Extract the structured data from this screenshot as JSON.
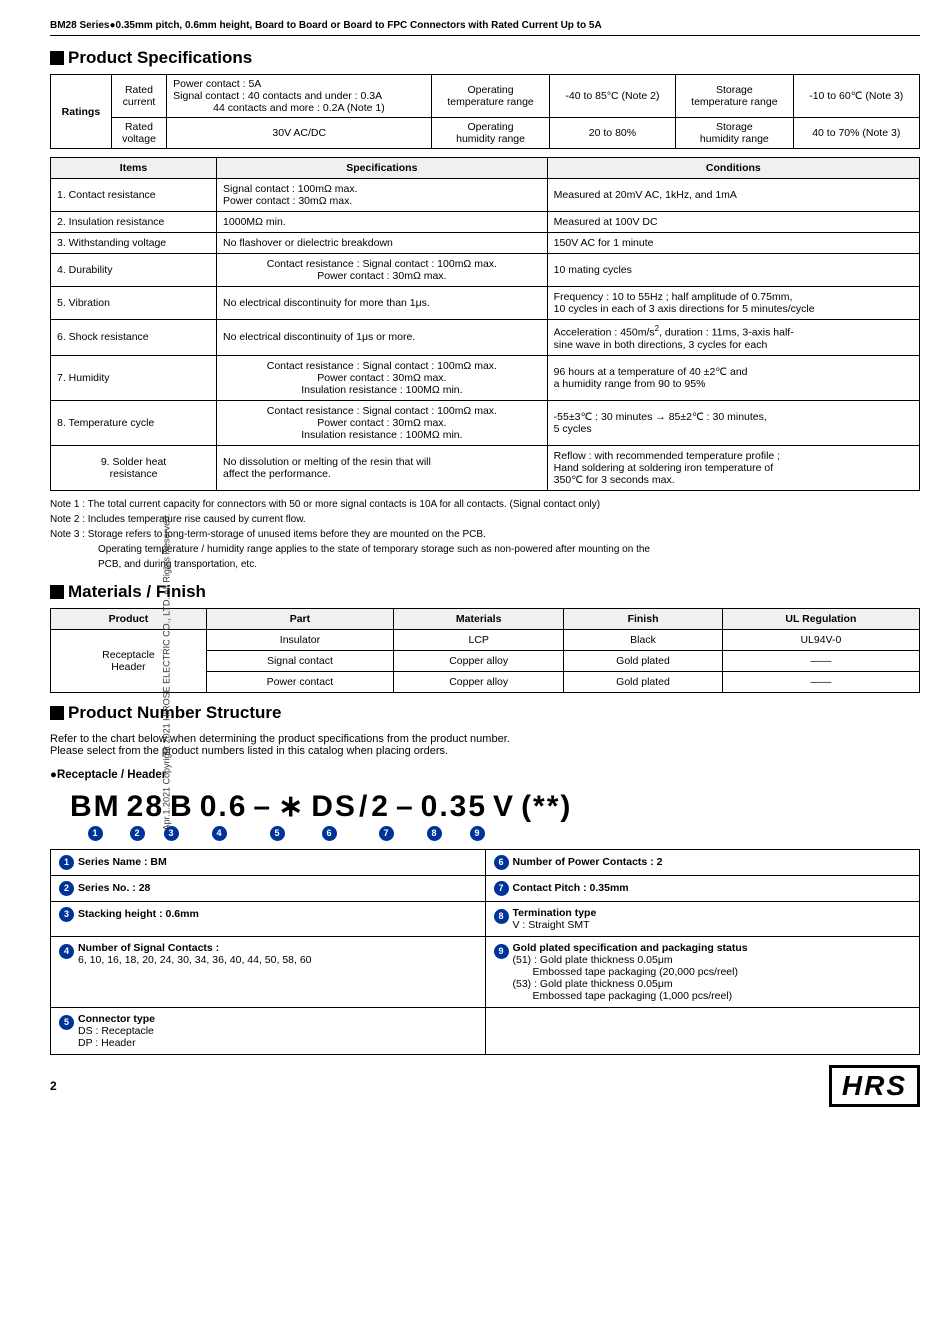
{
  "header": {
    "title": "BM28 Series●0.35mm pitch, 0.6mm height, Board to Board or Board to FPC Connectors with Rated Current Up to 5A"
  },
  "sidebar_text": "Apr.1.2021 Copyright 2021 HIROSE ELECTRIC CO., LTD. All Rights Reserved.",
  "product_specs": {
    "section_title": "Product Specifications",
    "ratings": {
      "label": "Ratings",
      "rows": [
        {
          "left_label": "Rated current",
          "left_value": "Power contact : 5A\nSignal contact : 40 contacts and under : 0.3A\n44 contacts and more : 0.2A (Note 1)",
          "mid_label": "Operating temperature range",
          "mid_value": "-40 to 85°C (Note 2)",
          "right_label": "Storage temperature range",
          "right_value": "-10 to 60℃ (Note 3)"
        },
        {
          "left_label": "Rated voltage",
          "left_value": "30V AC/DC",
          "mid_label": "Operating humidity range",
          "mid_value": "20 to 80%",
          "right_label": "Storage humidity range",
          "right_value": "40 to 70% (Note 3)"
        }
      ]
    },
    "main_table": {
      "headers": [
        "Items",
        "Specifications",
        "Conditions"
      ],
      "rows": [
        {
          "item": "1. Contact resistance",
          "spec": "Signal contact : 100mΩ max.\nPower contact : 30mΩ max.",
          "cond": "Measured at 20mV AC, 1kHz, and 1mA"
        },
        {
          "item": "2. Insulation resistance",
          "spec": "1000MΩ min.",
          "cond": "Measured at 100V DC"
        },
        {
          "item": "3. Withstanding voltage",
          "spec": "No flashover or dielectric breakdown",
          "cond": "150V AC for 1 minute"
        },
        {
          "item": "4. Durability",
          "spec": "Contact resistance : Signal contact : 100mΩ max.\nPower contact : 30mΩ max.",
          "cond": "10 mating cycles"
        },
        {
          "item": "5. Vibration",
          "spec": "No electrical discontinuity for more than 1μs.",
          "cond": "Frequency : 10 to 55Hz ; half amplitude of 0.75mm,\n10 cycles in each of 3 axis directions for 5 minutes/cycle"
        },
        {
          "item": "6. Shock resistance",
          "spec": "No electrical discontinuity of 1μs or more.",
          "cond": "Acceleration : 450m/s², duration : 11ms, 3-axis half-sine wave in both directions, 3 cycles for each"
        },
        {
          "item": "7. Humidity",
          "spec": "Contact resistance : Signal contact : 100mΩ max.\nPower contact : 30mΩ max.\nInsulation resistance : 100MΩ min.",
          "cond": "96 hours at a temperature of 40 ±2℃ and\na humidity range from 90 to 95%"
        },
        {
          "item": "8. Temperature cycle",
          "spec": "Contact resistance : Signal contact : 100mΩ max.\nPower contact : 30mΩ max.\nInsulation resistance : 100MΩ min.",
          "cond": "-55±3℃ : 30 minutes → 85±2℃ : 30 minutes,\n5 cycles"
        },
        {
          "item": "9. Solder heat\nresistance",
          "spec": "No dissolution or melting of the resin that will\naffect the performance.",
          "cond": "Reflow : with recommended temperature profile ;\nHand soldering at soldering iron temperature of\n350℃ for 3 seconds max."
        }
      ]
    },
    "notes": [
      "Note 1 : The total current capacity for connectors with 50 or more signal contacts is 10A for all contacts. (Signal contact only)",
      "Note 2 : Includes temperature rise caused by current flow.",
      "Note 3 : Storage refers to long-term-storage of unused items before they are mounted on the PCB.",
      "         Operating temperature / humidity range applies to the state of temporary storage such as non-powered after mounting on the",
      "         PCB, and during transportation, etc."
    ]
  },
  "materials": {
    "section_title": "Materials / Finish",
    "table": {
      "headers": [
        "Product",
        "Part",
        "Materials",
        "Finish",
        "UL Regulation"
      ],
      "rows": [
        {
          "product": "Receptacle\nHeader",
          "part": "Insulator",
          "materials": "LCP",
          "finish": "Black",
          "ul": "UL94V-0"
        },
        {
          "product": "",
          "part": "Signal contact",
          "materials": "Copper alloy",
          "finish": "Gold plated",
          "ul": "——"
        },
        {
          "product": "",
          "part": "Power contact",
          "materials": "Copper alloy",
          "finish": "Gold plated",
          "ul": "——"
        }
      ]
    }
  },
  "product_number": {
    "section_title": "Product Number Structure",
    "intro1": "Refer to the chart below when determining the product specifications from the product number.",
    "intro2": "Please select from the product numbers listed in this catalog when placing orders.",
    "subtitle": "●Receptacle / Header",
    "pn_display": "BM 28 B 0.6 – * DS / 2 – 0.35 V (**)",
    "circles": [
      "①",
      "②",
      "③",
      "④",
      "⑤",
      "⑥",
      "⑦",
      "⑧",
      "⑨"
    ],
    "circle_positions": [
      "BM",
      "28",
      "B",
      "*",
      "DS",
      "2",
      "0.35",
      "V",
      "(**)"
    ],
    "legend": [
      {
        "num": "①",
        "title": "Series Name : BM",
        "detail": ""
      },
      {
        "num": "⑥",
        "title": "Number of Power Contacts : 2",
        "detail": ""
      },
      {
        "num": "②",
        "title": "Series No. : 28",
        "detail": ""
      },
      {
        "num": "⑦",
        "title": "Contact Pitch : 0.35mm",
        "detail": ""
      },
      {
        "num": "③",
        "title": "Stacking height : 0.6mm",
        "detail": ""
      },
      {
        "num": "⑧",
        "title": "Termination type",
        "detail": "V : Straight SMT"
      },
      {
        "num": "④",
        "title": "Number of Signal Contacts :",
        "detail": "6, 10, 16, 18, 20, 24, 30, 34, 36, 40, 44, 50, 58, 60"
      },
      {
        "num": "⑨",
        "title": "Gold plated specification and packaging status",
        "detail": "(51) : Gold plate thickness 0.05μm\n       Embossed tape packaging (20,000 pcs/reel)\n(53) : Gold plate thickness 0.05μm\n       Embossed tape packaging (1,000 pcs/reel)"
      },
      {
        "num": "⑤",
        "title": "Connector type",
        "detail": "DS : Receptacle\nDP : Header"
      },
      {
        "num": "",
        "title": "",
        "detail": ""
      }
    ]
  },
  "footer": {
    "page": "2",
    "logo": "HRS"
  }
}
